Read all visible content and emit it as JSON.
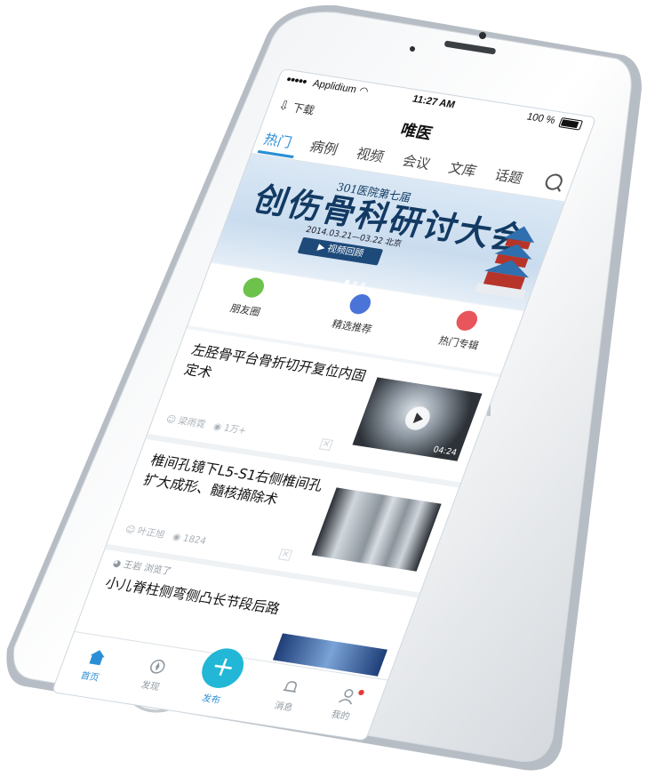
{
  "status_bar": {
    "carrier": "Applidium",
    "time": "11:27 AM",
    "battery": "100 %"
  },
  "nav": {
    "download_label": "下载",
    "title": "唯医"
  },
  "tabs": [
    {
      "label": "热门",
      "active": true
    },
    {
      "label": "病例",
      "active": false
    },
    {
      "label": "视频",
      "active": false
    },
    {
      "label": "会议",
      "active": false
    },
    {
      "label": "文库",
      "active": false
    },
    {
      "label": "话题",
      "active": false
    }
  ],
  "banner": {
    "subtitle": "301医院第七届",
    "title": "创伤骨科研讨大会",
    "date": "2014.03.21—03.22 北京",
    "button": "视频回顾"
  },
  "quick_links": [
    {
      "label": "朋友圈",
      "icon": "friends-icon",
      "color": "#6cc24a"
    },
    {
      "label": "精选推荐",
      "icon": "paper-plane-icon",
      "color": "#4a74d8"
    },
    {
      "label": "热门专辑",
      "icon": "flame-icon",
      "color": "#e8555a"
    }
  ],
  "feed": [
    {
      "title": "左胫骨平台骨折切开复位内固定术",
      "author": "梁雨霓",
      "views": "1万+",
      "duration": "04:24",
      "image": "xray-knee",
      "video": true
    },
    {
      "title": "椎间孔镜下L5-S1右侧椎间孔扩大成形、髓核摘除术",
      "author": "叶正旭",
      "views": "1824",
      "image": "xray-chest",
      "video": false
    },
    {
      "title": "小儿脊柱侧弯侧凸长节段后路",
      "user": "王岩",
      "action": "浏览了"
    }
  ],
  "tabbar": [
    {
      "label": "首页",
      "icon": "home-icon",
      "active": true
    },
    {
      "label": "发现",
      "icon": "discover-icon",
      "active": false
    },
    {
      "label": "发布",
      "icon": "plus-icon",
      "active": false
    },
    {
      "label": "消息",
      "icon": "bell-icon",
      "active": false
    },
    {
      "label": "我的",
      "icon": "user-icon",
      "active": false
    }
  ],
  "colors": {
    "accent": "#2b8fd6",
    "publish": "#22b7d6",
    "badge": "#e53935"
  }
}
